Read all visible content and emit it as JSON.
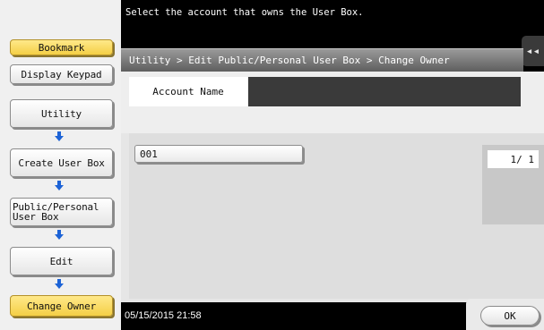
{
  "sidebar": {
    "bookmark_label": "Bookmark",
    "display_keypad_label": "Display Keypad",
    "steps": [
      {
        "label": "Utility"
      },
      {
        "label": "Create User Box"
      },
      {
        "label": "Public/Personal\nUser Box"
      },
      {
        "label": "Edit"
      },
      {
        "label": "Change Owner",
        "active": true
      }
    ],
    "arrow_icon": "down-arrow-icon",
    "active_color": "#f4cf46",
    "arrow_color": "#1d63d6"
  },
  "header": {
    "message": "Select the account that owns the User Box.",
    "breadcrumb": "Utility > Edit Public/Personal User Box > Change Owner",
    "collapse_icon": "double-chevron-left-icon",
    "collapse_glyph": "◂◂"
  },
  "account": {
    "label": "Account Name",
    "value": ""
  },
  "list": {
    "items": [
      {
        "label": "001"
      }
    ]
  },
  "pager": {
    "text": "1/  1"
  },
  "footer": {
    "datetime": "05/15/2015  21:58",
    "ok_label": "OK"
  }
}
